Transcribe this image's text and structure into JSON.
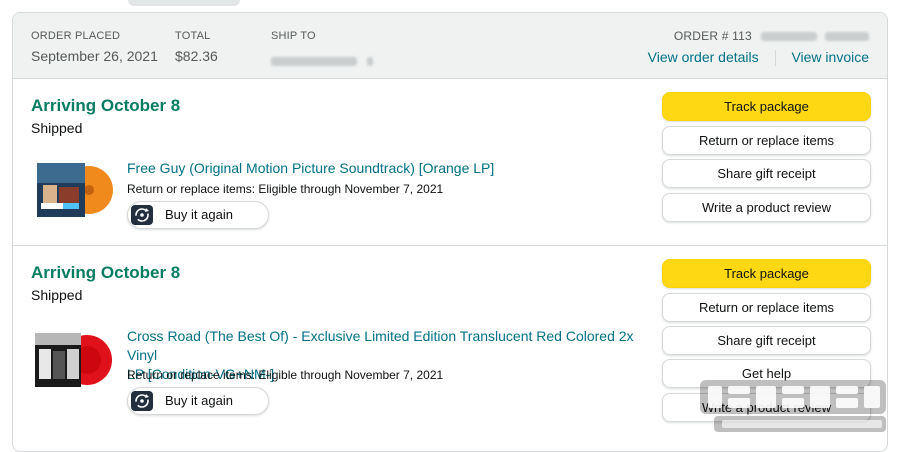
{
  "header": {
    "order_placed_label": "ORDER PLACED",
    "order_placed_value": "September 26, 2021",
    "total_label": "TOTAL",
    "total_value": "$82.36",
    "ship_to_label": "SHIP TO",
    "order_number_label": "ORDER # 113",
    "view_order_details": "View order details",
    "view_invoice": "View invoice"
  },
  "shipments": [
    {
      "arriving": "Arriving October 8",
      "status": "Shipped",
      "item_title": "Free Guy (Original Motion Picture Soundtrack) [Orange LP]",
      "eligibility": "Return or replace items: Eligible through November 7, 2021",
      "buy_again": "Buy it again",
      "actions": [
        "Track package",
        "Return or replace items",
        "Share gift receipt",
        "Write a product review"
      ]
    },
    {
      "arriving": "Arriving October 8",
      "status": "Shipped",
      "item_title_line1": "Cross Road (The Best Of) - Exclusive Limited Edition Translucent Red Colored 2x Vinyl",
      "item_title_line2": "LP [Condition-VG+NM-]",
      "eligibility": "Return or replace items: Eligible through November 7, 2021",
      "buy_again": "Buy it again",
      "actions": [
        "Track package",
        "Return or replace items",
        "Share gift receipt",
        "Get help",
        "Write a product review"
      ]
    }
  ],
  "colors": {
    "accent_green": "#067d62",
    "link_teal": "#007185",
    "button_yellow": "#ffd814"
  },
  "icons": {
    "buy_again": "buy-again-cycle-icon"
  }
}
